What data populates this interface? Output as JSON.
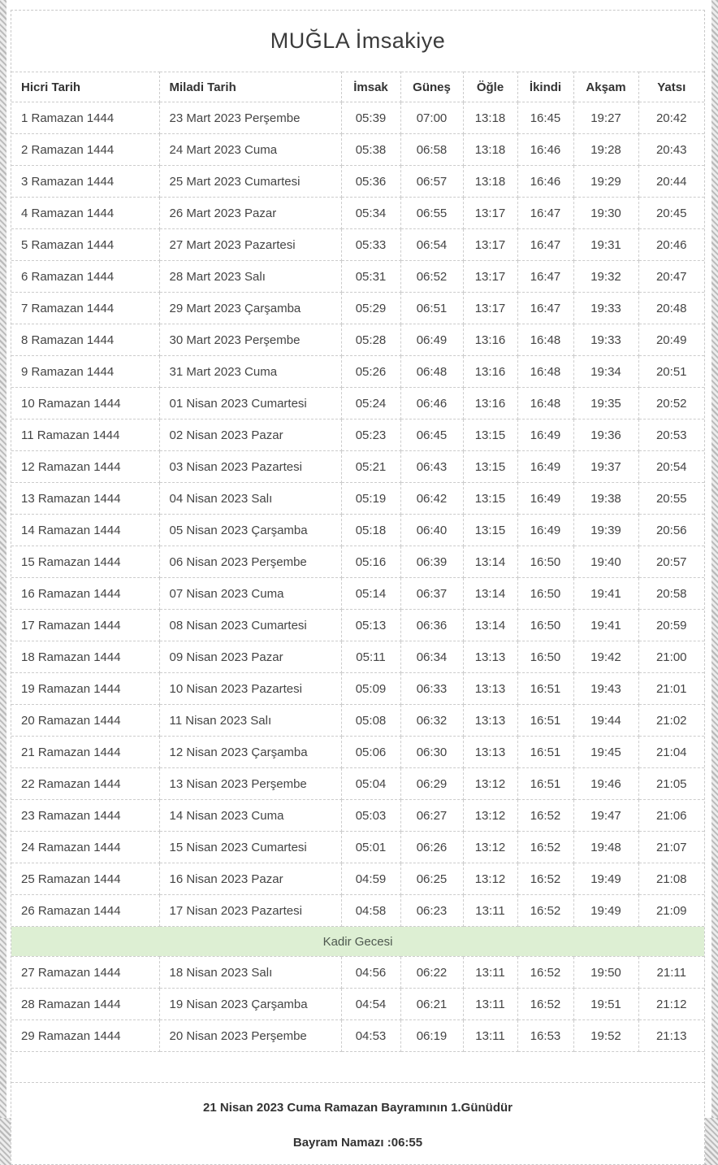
{
  "page": {
    "title": "MUĞLA İmsakiye"
  },
  "table": {
    "columns": [
      "Hicri Tarih",
      "Miladi Tarih",
      "İmsak",
      "Güneş",
      "Öğle",
      "İkindi",
      "Akşam",
      "Yatsı"
    ],
    "rows": [
      [
        "1 Ramazan 1444",
        "23 Mart 2023 Perşembe",
        "05:39",
        "07:00",
        "13:18",
        "16:45",
        "19:27",
        "20:42"
      ],
      [
        "2 Ramazan 1444",
        "24 Mart 2023 Cuma",
        "05:38",
        "06:58",
        "13:18",
        "16:46",
        "19:28",
        "20:43"
      ],
      [
        "3 Ramazan 1444",
        "25 Mart 2023 Cumartesi",
        "05:36",
        "06:57",
        "13:18",
        "16:46",
        "19:29",
        "20:44"
      ],
      [
        "4 Ramazan 1444",
        "26 Mart 2023 Pazar",
        "05:34",
        "06:55",
        "13:17",
        "16:47",
        "19:30",
        "20:45"
      ],
      [
        "5 Ramazan 1444",
        "27 Mart 2023 Pazartesi",
        "05:33",
        "06:54",
        "13:17",
        "16:47",
        "19:31",
        "20:46"
      ],
      [
        "6 Ramazan 1444",
        "28 Mart 2023 Salı",
        "05:31",
        "06:52",
        "13:17",
        "16:47",
        "19:32",
        "20:47"
      ],
      [
        "7 Ramazan 1444",
        "29 Mart 2023 Çarşamba",
        "05:29",
        "06:51",
        "13:17",
        "16:47",
        "19:33",
        "20:48"
      ],
      [
        "8 Ramazan 1444",
        "30 Mart 2023 Perşembe",
        "05:28",
        "06:49",
        "13:16",
        "16:48",
        "19:33",
        "20:49"
      ],
      [
        "9 Ramazan 1444",
        "31 Mart 2023 Cuma",
        "05:26",
        "06:48",
        "13:16",
        "16:48",
        "19:34",
        "20:51"
      ],
      [
        "10 Ramazan 1444",
        "01 Nisan 2023 Cumartesi",
        "05:24",
        "06:46",
        "13:16",
        "16:48",
        "19:35",
        "20:52"
      ],
      [
        "11 Ramazan 1444",
        "02 Nisan 2023 Pazar",
        "05:23",
        "06:45",
        "13:15",
        "16:49",
        "19:36",
        "20:53"
      ],
      [
        "12 Ramazan 1444",
        "03 Nisan 2023 Pazartesi",
        "05:21",
        "06:43",
        "13:15",
        "16:49",
        "19:37",
        "20:54"
      ],
      [
        "13 Ramazan 1444",
        "04 Nisan 2023 Salı",
        "05:19",
        "06:42",
        "13:15",
        "16:49",
        "19:38",
        "20:55"
      ],
      [
        "14 Ramazan 1444",
        "05 Nisan 2023 Çarşamba",
        "05:18",
        "06:40",
        "13:15",
        "16:49",
        "19:39",
        "20:56"
      ],
      [
        "15 Ramazan 1444",
        "06 Nisan 2023 Perşembe",
        "05:16",
        "06:39",
        "13:14",
        "16:50",
        "19:40",
        "20:57"
      ],
      [
        "16 Ramazan 1444",
        "07 Nisan 2023 Cuma",
        "05:14",
        "06:37",
        "13:14",
        "16:50",
        "19:41",
        "20:58"
      ],
      [
        "17 Ramazan 1444",
        "08 Nisan 2023 Cumartesi",
        "05:13",
        "06:36",
        "13:14",
        "16:50",
        "19:41",
        "20:59"
      ],
      [
        "18 Ramazan 1444",
        "09 Nisan 2023 Pazar",
        "05:11",
        "06:34",
        "13:13",
        "16:50",
        "19:42",
        "21:00"
      ],
      [
        "19 Ramazan 1444",
        "10 Nisan 2023 Pazartesi",
        "05:09",
        "06:33",
        "13:13",
        "16:51",
        "19:43",
        "21:01"
      ],
      [
        "20 Ramazan 1444",
        "11 Nisan 2023 Salı",
        "05:08",
        "06:32",
        "13:13",
        "16:51",
        "19:44",
        "21:02"
      ],
      [
        "21 Ramazan 1444",
        "12 Nisan 2023 Çarşamba",
        "05:06",
        "06:30",
        "13:13",
        "16:51",
        "19:45",
        "21:04"
      ],
      [
        "22 Ramazan 1444",
        "13 Nisan 2023 Perşembe",
        "05:04",
        "06:29",
        "13:12",
        "16:51",
        "19:46",
        "21:05"
      ],
      [
        "23 Ramazan 1444",
        "14 Nisan 2023 Cuma",
        "05:03",
        "06:27",
        "13:12",
        "16:52",
        "19:47",
        "21:06"
      ],
      [
        "24 Ramazan 1444",
        "15 Nisan 2023 Cumartesi",
        "05:01",
        "06:26",
        "13:12",
        "16:52",
        "19:48",
        "21:07"
      ],
      [
        "25 Ramazan 1444",
        "16 Nisan 2023 Pazar",
        "04:59",
        "06:25",
        "13:12",
        "16:52",
        "19:49",
        "21:08"
      ],
      [
        "26 Ramazan 1444",
        "17 Nisan 2023 Pazartesi",
        "04:58",
        "06:23",
        "13:11",
        "16:52",
        "19:49",
        "21:09"
      ],
      [
        "27 Ramazan 1444",
        "18 Nisan 2023 Salı",
        "04:56",
        "06:22",
        "13:11",
        "16:52",
        "19:50",
        "21:11"
      ],
      [
        "28 Ramazan 1444",
        "19 Nisan 2023 Çarşamba",
        "04:54",
        "06:21",
        "13:11",
        "16:52",
        "19:51",
        "21:12"
      ],
      [
        "29 Ramazan 1444",
        "20 Nisan 2023 Perşembe",
        "04:53",
        "06:19",
        "13:11",
        "16:53",
        "19:52",
        "21:13"
      ]
    ]
  },
  "kadir_band": {
    "label": "Kadir Gecesi",
    "before_row_index": 26
  },
  "footer": {
    "line1": "21 Nisan 2023 Cuma Ramazan Bayramının 1.Günüdür",
    "line2": "Bayram Namazı :06:55"
  },
  "colors": {
    "kadir_background": "#ddefd3",
    "border": "#cccccc",
    "text": "#444444"
  }
}
